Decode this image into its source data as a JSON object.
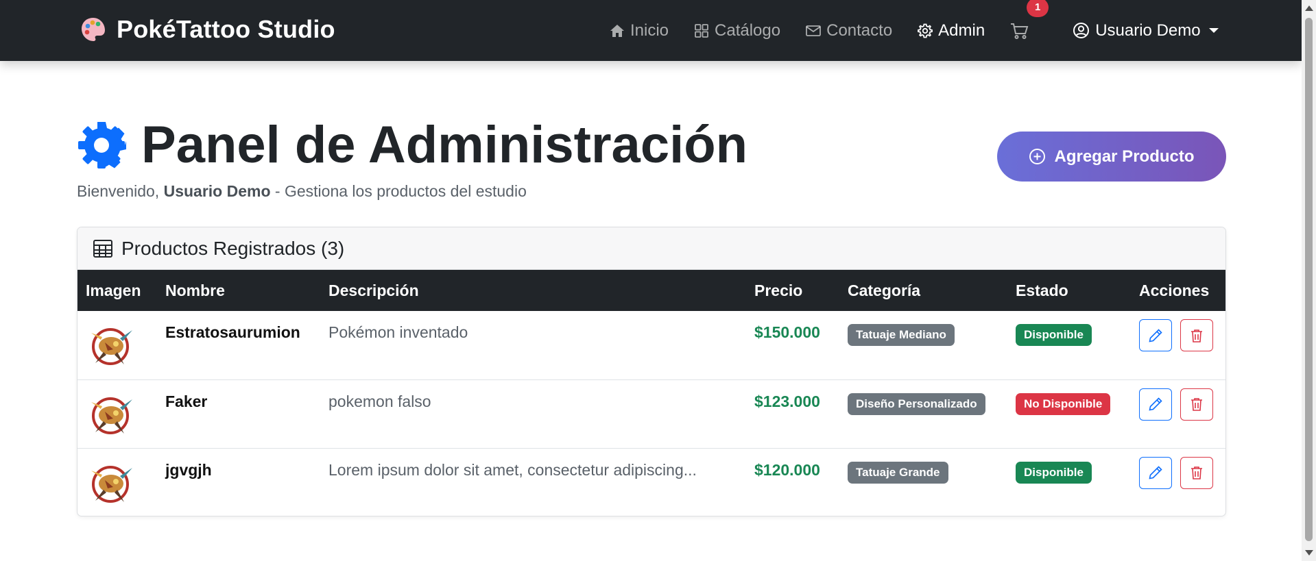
{
  "navbar": {
    "brand": "PokéTattoo Studio",
    "links": [
      {
        "label": "Inicio",
        "icon": "house-icon"
      },
      {
        "label": "Catálogo",
        "icon": "grid-icon"
      },
      {
        "label": "Contacto",
        "icon": "envelope-icon"
      },
      {
        "label": "Admin",
        "icon": "gear-icon"
      }
    ],
    "cart_count": "1",
    "user": "Usuario Demo"
  },
  "header": {
    "title": "Panel de Administración",
    "subtitle_prefix": "Bienvenido, ",
    "subtitle_user": "Usuario Demo",
    "subtitle_suffix": " - Gestiona los productos del estudio",
    "add_button": "Agregar Producto"
  },
  "card": {
    "title": "Productos Registrados (3)"
  },
  "table": {
    "columns": [
      "Imagen",
      "Nombre",
      "Descripción",
      "Precio",
      "Categoría",
      "Estado",
      "Acciones"
    ],
    "rows": [
      {
        "name": "Estratosaurumion",
        "description": "Pokémon inventado",
        "price": "$150.000",
        "category": "Tatuaje Mediano",
        "status": "Disponible",
        "status_color": "#198754"
      },
      {
        "name": "Faker",
        "description": "pokemon falso",
        "price": "$123.000",
        "category": "Diseño Personalizado",
        "status": "No Disponible",
        "status_color": "#dc3545"
      },
      {
        "name": "jgvgjh",
        "description": "Lorem ipsum dolor sit amet, consectetur adipiscing...",
        "price": "$120.000",
        "category": "Tatuaje Grande",
        "status": "Disponible",
        "status_color": "#198754"
      }
    ]
  },
  "colors": {
    "navbar": "#212529",
    "accent_gradient_start": "#6a6fd8",
    "accent_gradient_end": "#7a55b8",
    "price": "#198754",
    "primary": "#0d6efd",
    "danger": "#dc3545"
  }
}
